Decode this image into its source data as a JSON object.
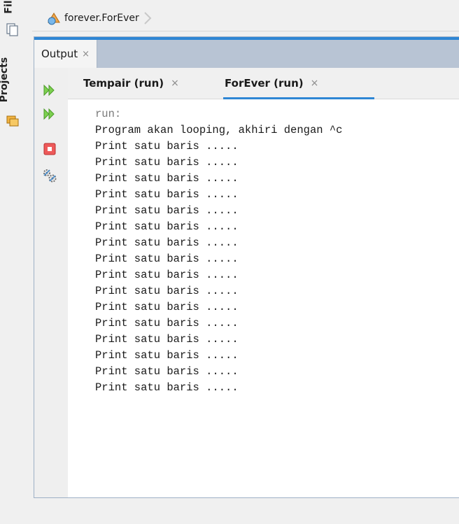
{
  "side_strip": {
    "files_label": "Fil",
    "projects_label": "Projects",
    "icons": [
      "files-icon",
      "projects-icon"
    ]
  },
  "breadcrumb": {
    "icon": "java-class-icon",
    "text": "forever.ForEver"
  },
  "output": {
    "tab_label": "Output",
    "close_glyph": "×",
    "toolbar_icons": [
      "rerun-icon",
      "rerun-with-options-icon",
      "stop-icon",
      "settings-icon"
    ],
    "colors": {
      "accent": "#2e86d4",
      "header_bg": "#b8c4d4",
      "rerun_green": "#6cc24a",
      "stop_red": "#e84b4b"
    },
    "sub_tabs": [
      {
        "label": "Tempair (run)",
        "active": false
      },
      {
        "label": "ForEver (run)",
        "active": true
      }
    ],
    "lines": [
      "run:",
      "Program akan looping, akhiri dengan ^c",
      "Print satu baris .....",
      "Print satu baris .....",
      "Print satu baris .....",
      "Print satu baris .....",
      "Print satu baris .....",
      "Print satu baris .....",
      "Print satu baris .....",
      "Print satu baris .....",
      "Print satu baris .....",
      "Print satu baris .....",
      "Print satu baris .....",
      "Print satu baris .....",
      "Print satu baris .....",
      "Print satu baris .....",
      "Print satu baris .....",
      "Print satu baris ....."
    ]
  }
}
